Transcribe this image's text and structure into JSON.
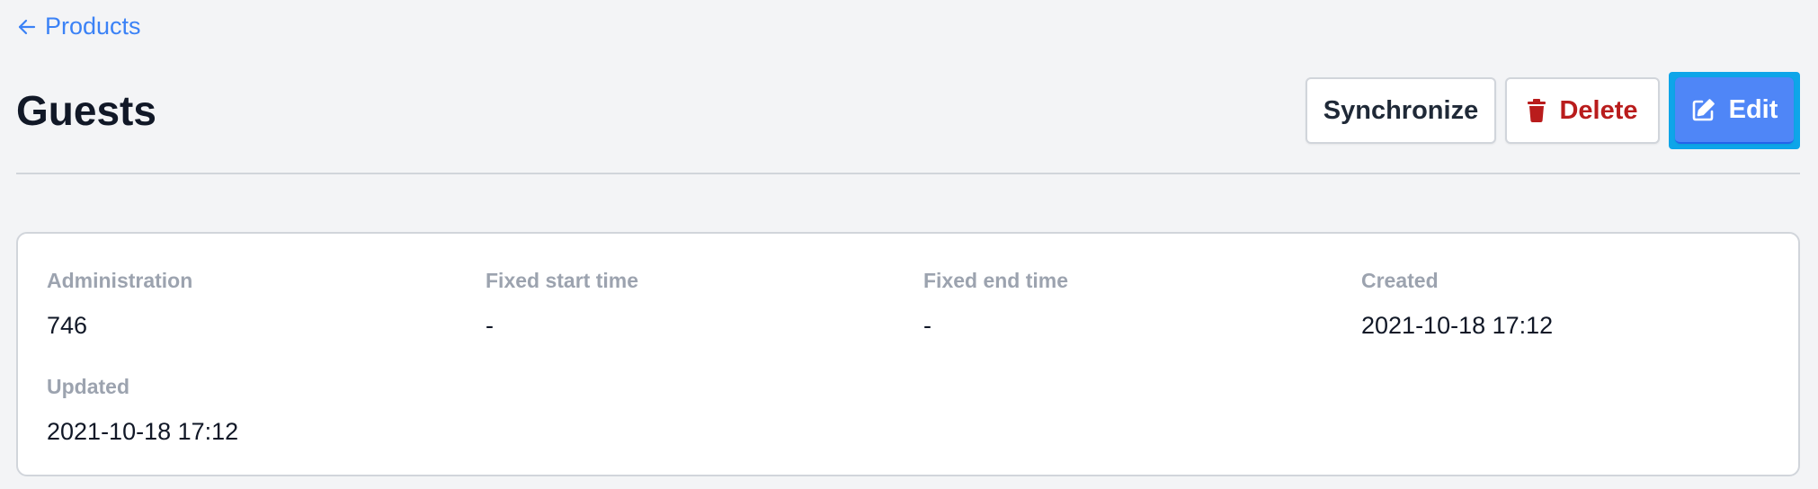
{
  "breadcrumb": {
    "back_label": "Products"
  },
  "header": {
    "title": "Guests"
  },
  "actions": {
    "synchronize_label": "Synchronize",
    "delete_label": "Delete",
    "edit_label": "Edit"
  },
  "details": {
    "fields": [
      {
        "label": "Administration",
        "value": "746"
      },
      {
        "label": "Fixed start time",
        "value": "-"
      },
      {
        "label": "Fixed end time",
        "value": "-"
      },
      {
        "label": "Created",
        "value": "2021-10-18 17:12"
      },
      {
        "label": "Updated",
        "value": "2021-10-18 17:12"
      }
    ]
  },
  "icons": {
    "back": "arrow-left-icon",
    "delete": "trash-icon",
    "edit": "pencil-square-icon"
  },
  "colors": {
    "link": "#3b82f6",
    "danger": "#b91c1c",
    "primary": "#4f86f7",
    "focus_ring": "#0ea5e9",
    "label_gray": "#9ca3af",
    "background": "#f3f4f6"
  }
}
